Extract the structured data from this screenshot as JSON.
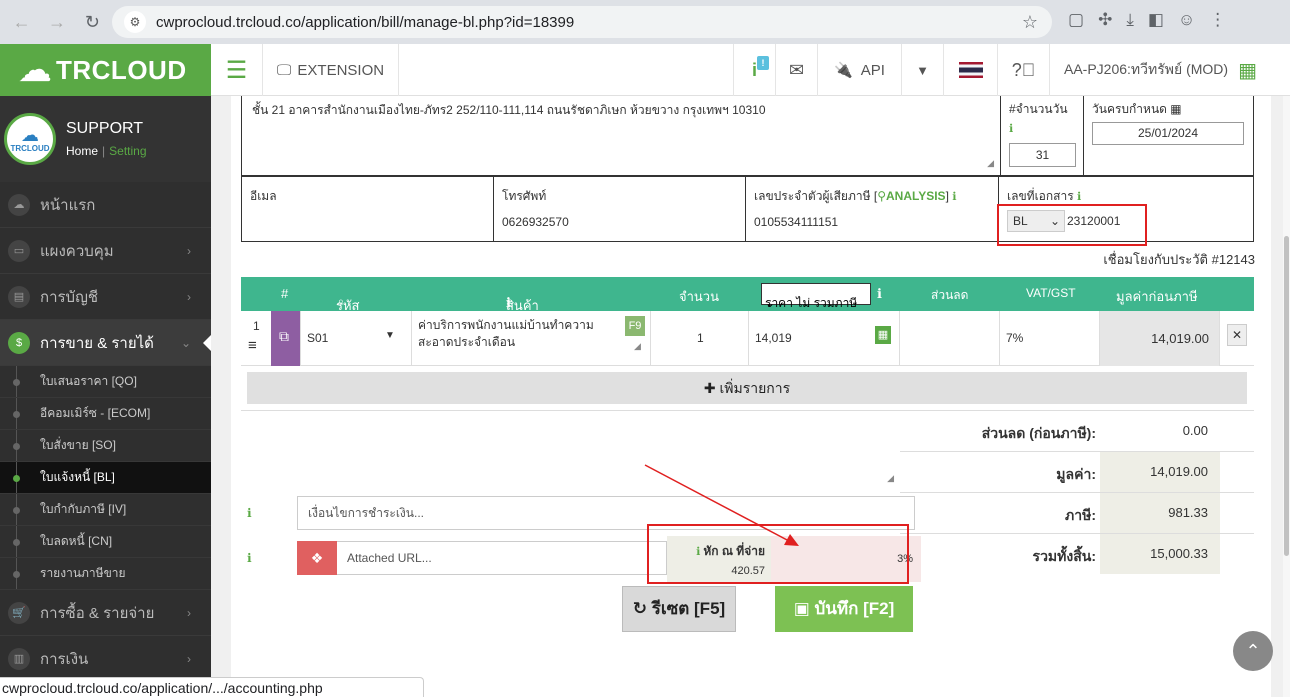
{
  "browser": {
    "url": "cwprocloud.trcloud.co/application/bill/manage-bl.php?id=18399",
    "status_url": "cwprocloud.trcloud.co/application/.../accounting.php"
  },
  "topbar": {
    "brand": "TRCLOUD",
    "extension_label": "EXTENSION",
    "info_badge": "!",
    "api_label": "API",
    "user_label": "AA-PJ206:ทวีทรัพย์ (MOD)"
  },
  "sidebar": {
    "logo_text": "TRCLOUD",
    "profile_name": "SUPPORT",
    "home_link": "Home",
    "setting_link": "Setting",
    "items": [
      {
        "label": "หน้าแรก"
      },
      {
        "label": "แผงควบคุม"
      },
      {
        "label": "การบัญชี"
      },
      {
        "label": "การขาย & รายได้"
      },
      {
        "label": "การซื้อ & รายจ่าย"
      },
      {
        "label": "การเงิน"
      }
    ],
    "subitems": [
      {
        "label": "ใบเสนอราคา [QO]"
      },
      {
        "label": "อีคอมเมิร์ซ - [ECOM]"
      },
      {
        "label": "ใบสั่งขาย [SO]"
      },
      {
        "label": "ใบแจ้งหนี้ [BL]"
      },
      {
        "label": "ใบกำกับภาษี [IV]"
      },
      {
        "label": "ใบลดหนี้ [CN]"
      },
      {
        "label": "รายงานภาษีขาย"
      }
    ]
  },
  "form": {
    "address": "ชั้น 21 อาคารสำนักงานเมืองไทย-ภัทร2 252/110-111,114 ถนนรัชดาภิเษก ห้วยขวาง กรุงเทพฯ 10310",
    "days_label": "#จำนวนวัน",
    "days_value": "31",
    "due_label": "วันครบกำหนด",
    "due_value": "25/01/2024",
    "email_label": "อีเมล",
    "email_value": "",
    "phone_label": "โทรศัพท์",
    "phone_value": "0626932570",
    "taxid_label": "เลขประจำตัวผู้เสียภาษี",
    "analysis_label": "ANALYSIS",
    "taxid_value": "0105534111151",
    "docno_label": "เลขที่เอกสาร",
    "doc_prefix": "BL",
    "doc_number": "23120001",
    "link_history": "เชื่อมโยงกับประวัติ #12143"
  },
  "table": {
    "headers": {
      "num": "#",
      "code": "รหัส",
      "product": "สินค้า",
      "qty": "จำนวน",
      "price_select": "ราคา ไม่ รวมภาษี",
      "discount": "ส่วนลด",
      "vat": "VAT/GST",
      "pretax": "มูลค่าก่อนภาษี"
    },
    "rows": [
      {
        "num": "1",
        "code": "S01",
        "product": "ค่าบริการพนักงานแม่บ้านทำความสะอาดประจำเดือน",
        "fkey": "F9",
        "qty": "1",
        "price": "14,019",
        "discount": "",
        "vat": "7%",
        "pretax": "14,019.00"
      }
    ],
    "add_row_label": "เพิ่มรายการ"
  },
  "summary": {
    "discount_label": "ส่วนลด (ก่อนภาษี):",
    "discount_value": "0.00",
    "value_label": "มูลค่า:",
    "value_value": "14,019.00",
    "tax_label": "ภาษี:",
    "tax_value": "981.33",
    "total_label": "รวมทั้งสิ้น:",
    "total_value": "15,000.33"
  },
  "footer": {
    "payment_cond_placeholder": "เงื่อนไขการชำระเงิน...",
    "attach_placeholder": "Attached URL...",
    "wht_label": "หัก ณ ที่จ่าย",
    "wht_amount": "420.57",
    "wht_percent": "3%",
    "reset_label": "รีเซต [F5]",
    "save_label": "บันทึก [F2]"
  },
  "colors": {
    "brand_green": "#5aa945",
    "table_header": "#3fb68e",
    "highlight_red": "#e02020"
  }
}
